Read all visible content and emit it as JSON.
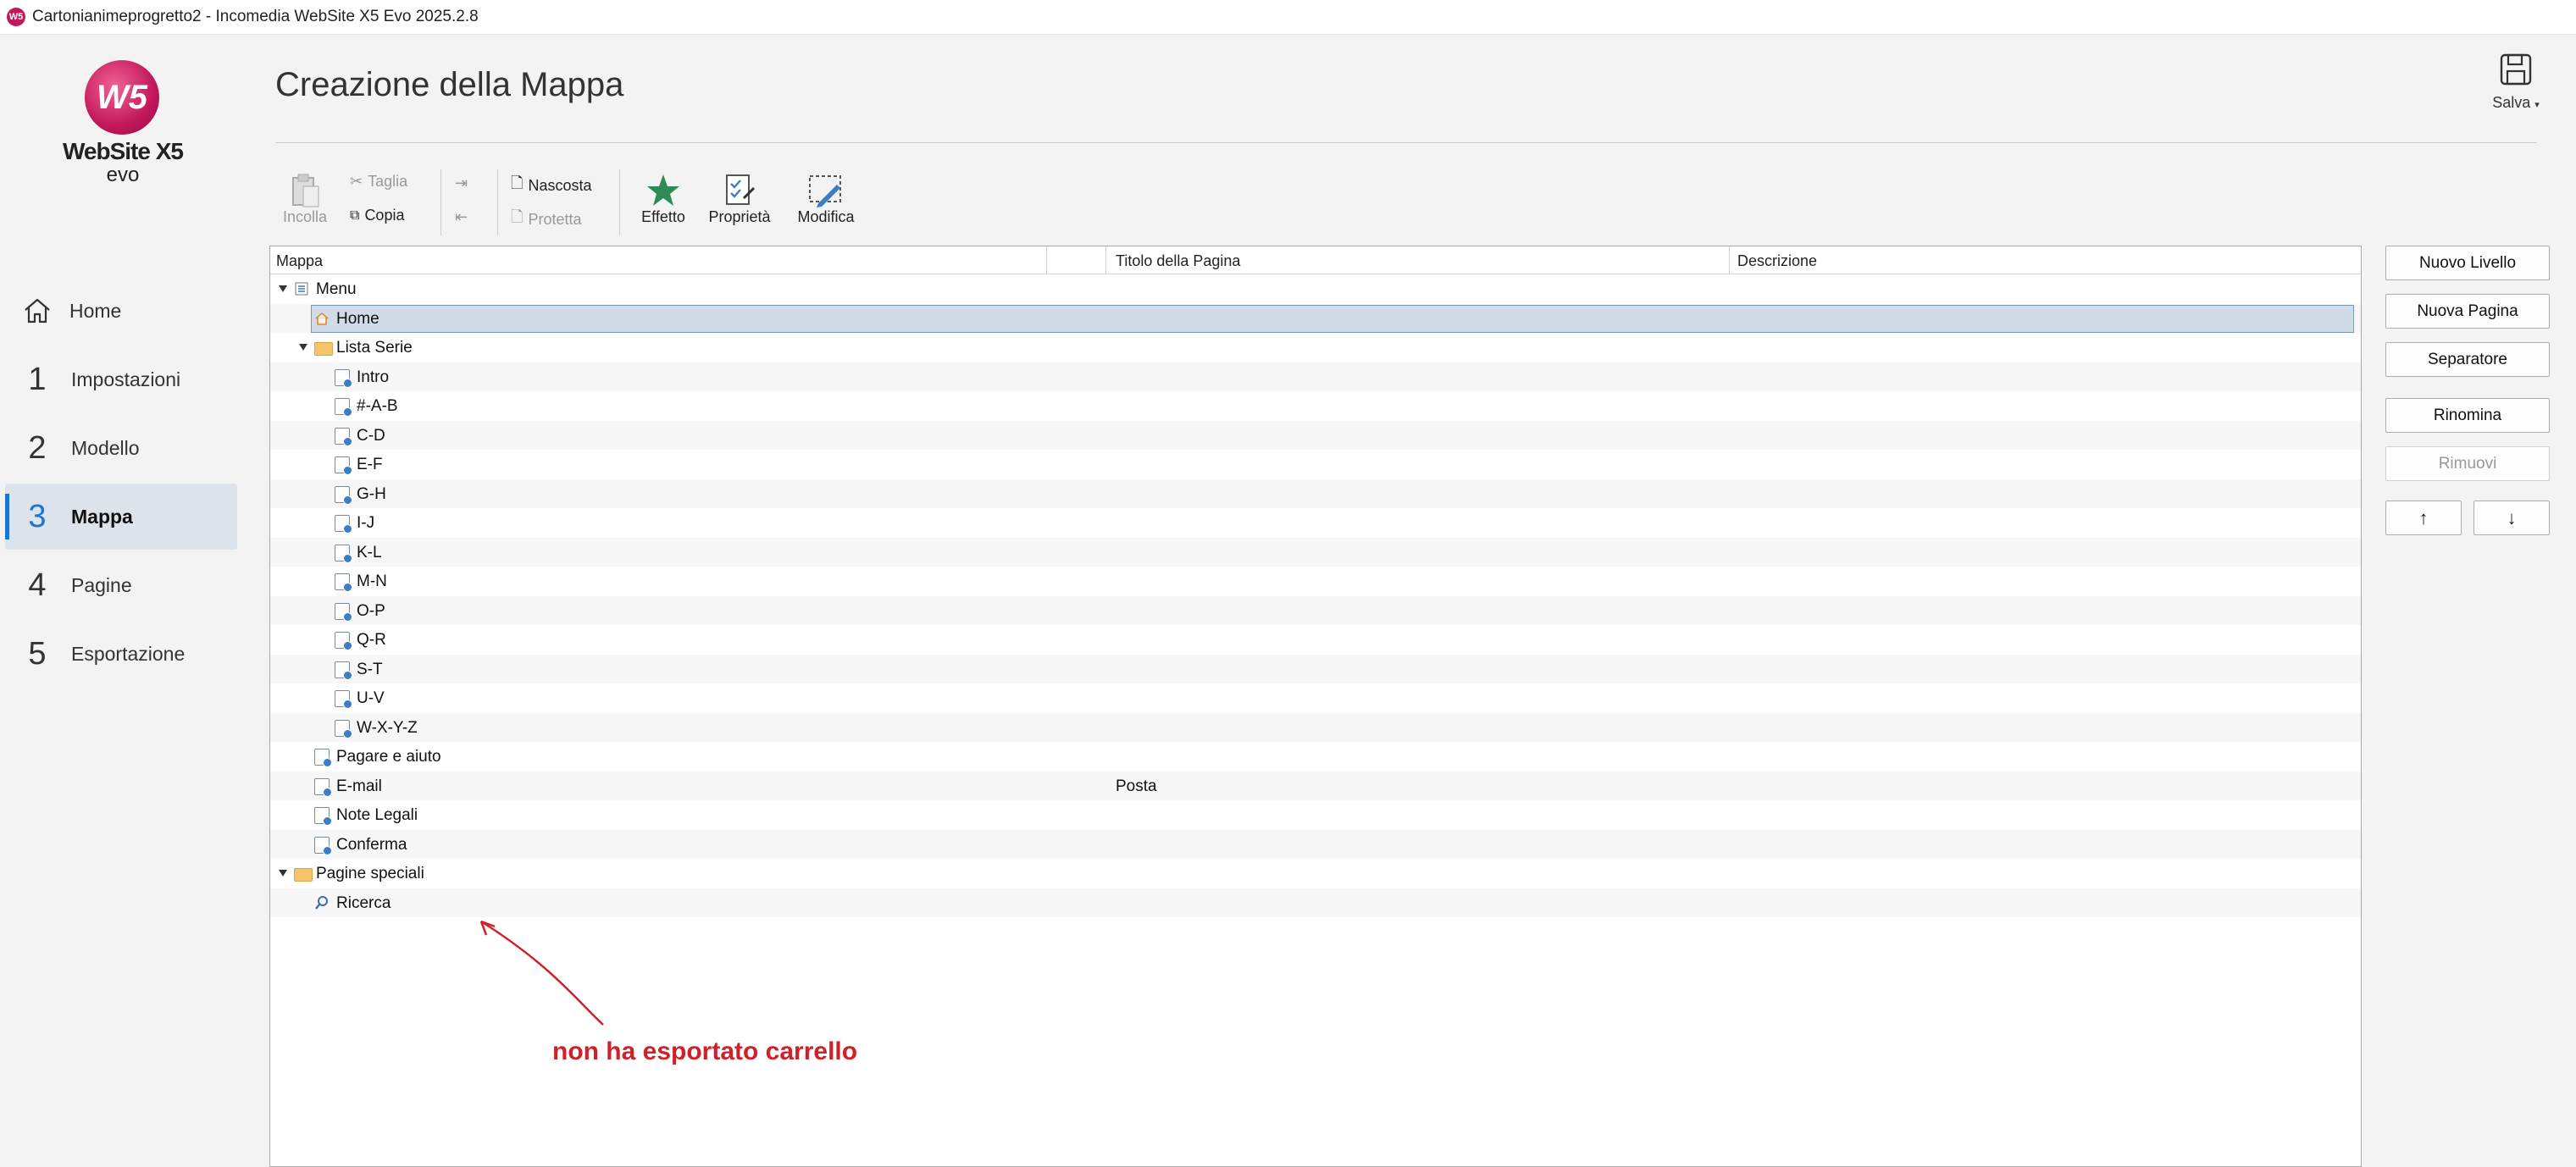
{
  "window": {
    "title": "Cartonianimeprogretto2 - Incomedia WebSite X5 Evo 2025.2.8"
  },
  "logo": {
    "mark": "W5",
    "brand": "WebSite X5",
    "sub": "evo"
  },
  "nav": [
    {
      "num": "",
      "label": "Home",
      "icon": "home-icon"
    },
    {
      "num": "1",
      "label": "Impostazioni"
    },
    {
      "num": "2",
      "label": "Modello"
    },
    {
      "num": "3",
      "label": "Mappa",
      "active": true
    },
    {
      "num": "4",
      "label": "Pagine"
    },
    {
      "num": "5",
      "label": "Esportazione"
    }
  ],
  "header": {
    "title": "Creazione della Mappa",
    "save_label": "Salva"
  },
  "toolbar": {
    "paste": "Incolla",
    "cut": "Taglia",
    "copy": "Copia",
    "hidden": "Nascosta",
    "protected": "Protetta",
    "effect": "Effetto",
    "properties": "Proprietà",
    "edit": "Modifica"
  },
  "tree": {
    "columns": [
      "Mappa",
      "Titolo della Pagina",
      "Descrizione"
    ],
    "rows": [
      {
        "label": "Menu",
        "level": 0,
        "expander": true,
        "icon": "menu-icon",
        "title": ""
      },
      {
        "label": "Home",
        "level": 1,
        "icon": "home-icon",
        "title": "",
        "selected": true
      },
      {
        "label": "Lista Serie",
        "level": 1,
        "expander": true,
        "icon": "folder-icon",
        "title": ""
      },
      {
        "label": "Intro",
        "level": 2,
        "icon": "page-icon",
        "title": ""
      },
      {
        "label": "#-A-B",
        "level": 2,
        "icon": "page-icon",
        "title": ""
      },
      {
        "label": "C-D",
        "level": 2,
        "icon": "page-icon",
        "title": ""
      },
      {
        "label": "E-F",
        "level": 2,
        "icon": "page-icon",
        "title": ""
      },
      {
        "label": "G-H",
        "level": 2,
        "icon": "page-icon",
        "title": ""
      },
      {
        "label": "I-J",
        "level": 2,
        "icon": "page-icon",
        "title": ""
      },
      {
        "label": "K-L",
        "level": 2,
        "icon": "page-icon",
        "title": ""
      },
      {
        "label": "M-N",
        "level": 2,
        "icon": "page-icon",
        "title": ""
      },
      {
        "label": "O-P",
        "level": 2,
        "icon": "page-icon",
        "title": ""
      },
      {
        "label": "Q-R",
        "level": 2,
        "icon": "page-icon",
        "title": ""
      },
      {
        "label": "S-T",
        "level": 2,
        "icon": "page-icon",
        "title": ""
      },
      {
        "label": "U-V",
        "level": 2,
        "icon": "page-icon",
        "title": ""
      },
      {
        "label": "W-X-Y-Z",
        "level": 2,
        "icon": "page-icon",
        "title": ""
      },
      {
        "label": "Pagare e aiuto",
        "level": 1,
        "icon": "page-icon",
        "title": ""
      },
      {
        "label": "E-mail",
        "level": 1,
        "icon": "page-icon",
        "title": "Posta"
      },
      {
        "label": "Note Legali",
        "level": 1,
        "icon": "page-icon",
        "title": ""
      },
      {
        "label": "Conferma",
        "level": 1,
        "icon": "page-icon",
        "title": ""
      },
      {
        "label": "Pagine speciali",
        "level": 0,
        "expander": true,
        "icon": "folder-icon",
        "title": ""
      },
      {
        "label": "Ricerca",
        "level": 1,
        "icon": "search-icon",
        "title": ""
      }
    ]
  },
  "actions": {
    "new_level": "Nuovo Livello",
    "new_page": "Nuova Pagina",
    "separator": "Separatore",
    "rename": "Rinomina",
    "remove": "Rimuovi",
    "up": "↑",
    "down": "↓"
  },
  "annotation": {
    "text": "non ha esportato carrello",
    "color": "#d0202a"
  }
}
